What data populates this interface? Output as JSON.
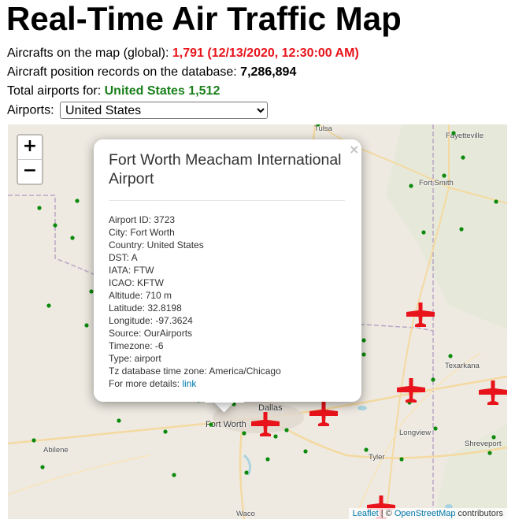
{
  "page": {
    "title": "Real-Time Air Traffic Map",
    "aircrafts_label": "Aircrafts on the map (global):",
    "aircrafts_value": "1,791 (12/13/2020, 12:30:00 AM)",
    "positions_label": "Aircraft position records on the database:",
    "positions_value": "7,286,894",
    "airports_total_label": "Total airports for:",
    "airports_total_value": "United States 1,512",
    "airports_select_label": "Airports:",
    "airports_select_value": "United States"
  },
  "map": {
    "zoom_in": "+",
    "zoom_out": "−",
    "cities": {
      "tulsa": "Tulsa",
      "fayetteville": "Fayetteville",
      "fort_smith": "Fort Smith",
      "texarkana": "Texarkana",
      "dallas": "Dallas",
      "fort_worth": "Fort Worth",
      "longview": "Longview",
      "shreveport": "Shreveport",
      "abilene": "Abilene",
      "tyler": "Tyler",
      "waco": "Waco"
    },
    "attribution": {
      "leaflet": "Leaflet",
      "separator": " | © ",
      "osm": "OpenStreetMap",
      "contributors": " contributors"
    },
    "colors": {
      "airport_dot": "#0b8a0b",
      "aircraft": "#e8131b",
      "land": "#eeeae2",
      "roads": "#f4d9a0",
      "border": "#b9a6c6"
    }
  },
  "popup": {
    "close": "×",
    "title": "Fort Worth Meacham International Airport",
    "lines": [
      "Airport ID: 3723",
      "City: Fort Worth",
      "Country: United States",
      "DST: A",
      "IATA: FTW",
      "ICAO: KFTW",
      "Altitude: 710 m",
      "Latitude: 32.8198",
      "Longitude: -97.3624",
      "Source: OurAirports",
      "Timezone: -6",
      "Type: airport",
      "Tz database time zone: America/Chicago"
    ],
    "details_label": "For more details:",
    "details_link": "link"
  }
}
